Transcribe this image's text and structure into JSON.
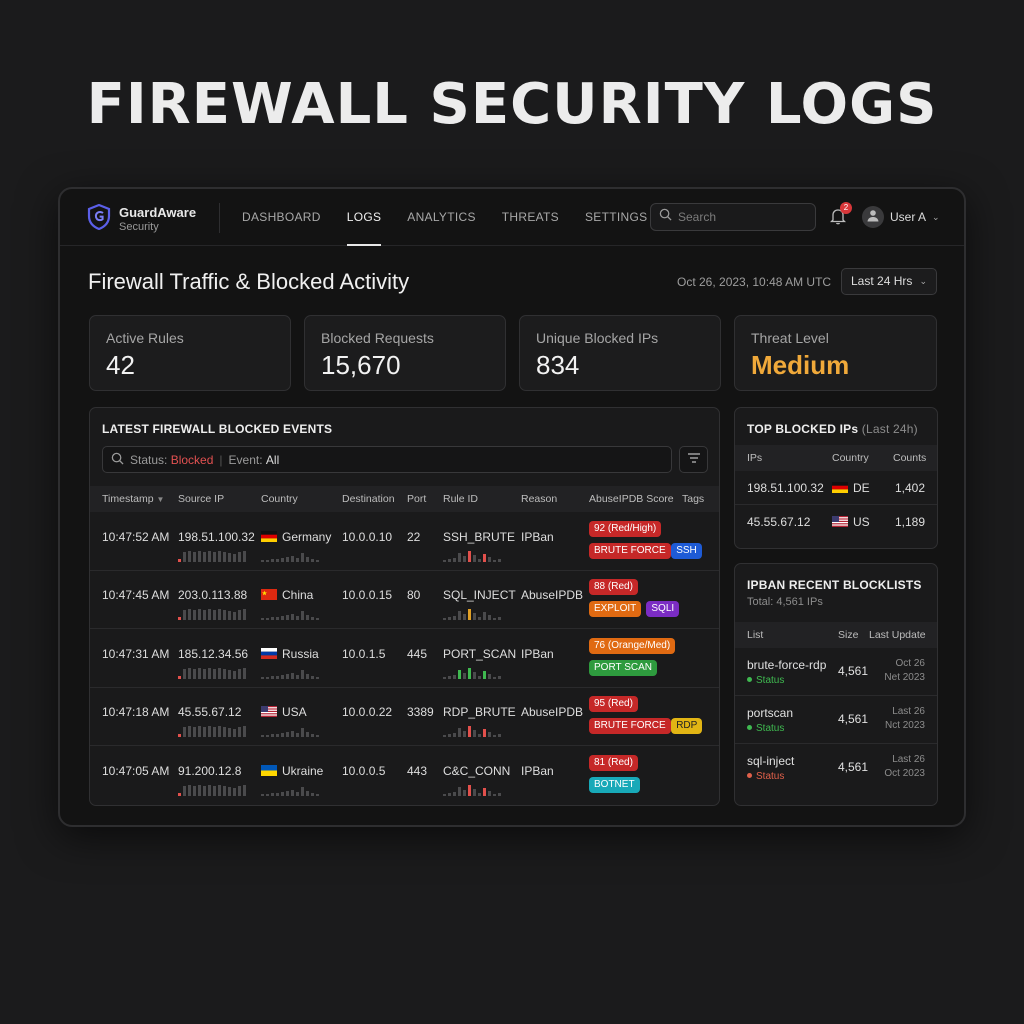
{
  "hero_title": "FIREWALL SECURITY LOGS",
  "app": {
    "name": "GuardAware",
    "subtitle": "Security"
  },
  "nav": [
    {
      "label": "DASHBOARD",
      "active": false
    },
    {
      "label": "LOGS",
      "active": true
    },
    {
      "label": "ANALYTICS",
      "active": false
    },
    {
      "label": "THREATS",
      "active": false
    },
    {
      "label": "SETTINGS",
      "active": false
    }
  ],
  "search": {
    "placeholder": "Search"
  },
  "notifications": {
    "count": "2"
  },
  "user": {
    "name": "User A"
  },
  "page": {
    "title": "Firewall Traffic & Blocked Activity",
    "timestamp": "Oct 26, 2023, 10:48 AM UTC",
    "range": "Last 24 Hrs"
  },
  "stats": [
    {
      "label": "Active Rules",
      "value": "42"
    },
    {
      "label": "Blocked Requests",
      "value": "15,670"
    },
    {
      "label": "Unique Blocked IPs",
      "value": "834"
    },
    {
      "label": "Threat Level",
      "value": "Medium"
    }
  ],
  "events": {
    "title": "LATEST FIREWALL BLOCKED EVENTS",
    "filter": {
      "status_label": "Status:",
      "status_value": "Blocked",
      "event_label": "Event:",
      "event_value": "All"
    },
    "columns": [
      "Timestamp",
      "Source IP",
      "Country",
      "Destination",
      "Port",
      "Rule ID",
      "Reason",
      "AbuseIPDB Score",
      "Tags"
    ],
    "rows": [
      {
        "time": "10:47:52 AM",
        "ip": "198.51.100.32",
        "country": "Germany",
        "flag": "de",
        "dest": "10.0.0.10",
        "port": "22",
        "rule": "SSH_BRUTE",
        "reason": "IPBan",
        "score": "92 (Red/High)",
        "score_color": "#c62828",
        "tags": [
          {
            "label": "BRUTE FORCE",
            "color": "#c62828"
          },
          {
            "label": "SSH",
            "color": "#1e5bd6"
          }
        ]
      },
      {
        "time": "10:47:45 AM",
        "ip": "203.0.113.88",
        "country": "China",
        "flag": "cn",
        "dest": "10.0.0.15",
        "port": "80",
        "rule": "SQL_INJECT",
        "reason": "AbuseIPDB",
        "score": "88 (Red)",
        "score_color": "#c62828",
        "tags": [
          {
            "label": "EXPLOIT",
            "color": "#e06a12"
          },
          {
            "label": "SQLI",
            "color": "#7b2cc4"
          }
        ]
      },
      {
        "time": "10:47:31 AM",
        "ip": "185.12.34.56",
        "country": "Russia",
        "flag": "ru",
        "dest": "10.0.1.5",
        "port": "445",
        "rule": "PORT_SCAN",
        "reason": "IPBan",
        "score": "76 (Orange/Med)",
        "score_color": "#e06a12",
        "tags": [
          {
            "label": "PORT SCAN",
            "color": "#2e9b3e"
          }
        ]
      },
      {
        "time": "10:47:18 AM",
        "ip": "45.55.67.12",
        "country": "USA",
        "flag": "us",
        "dest": "10.0.0.22",
        "port": "3389",
        "rule": "RDP_BRUTE",
        "reason": "AbuseIPDB",
        "score": "95 (Red)",
        "score_color": "#c62828",
        "tags": [
          {
            "label": "BRUTE FORCE",
            "color": "#c62828"
          },
          {
            "label": "RDP",
            "color": "#e2b514"
          }
        ]
      },
      {
        "time": "10:47:05 AM",
        "ip": "91.200.12.8",
        "country": "Ukraine",
        "flag": "ua",
        "dest": "10.0.0.5",
        "port": "443",
        "rule": "C&C_CONN",
        "reason": "IPBan",
        "score": "81 (Red)",
        "score_color": "#c62828",
        "tags": [
          {
            "label": "BOTNET",
            "color": "#18a9b8"
          }
        ]
      }
    ]
  },
  "top_ips": {
    "title": "TOP BLOCKED IPs",
    "title_suffix": "(Last 24h)",
    "columns": [
      "IPs",
      "Country",
      "Counts"
    ],
    "rows": [
      {
        "ip": "198.51.100.32",
        "country": "DE",
        "flag": "de",
        "count": "1,402"
      },
      {
        "ip": "45.55.67.12",
        "country": "US",
        "flag": "us",
        "count": "1,189"
      }
    ]
  },
  "blocklists": {
    "title": "IPBAN RECENT BLOCKLISTS",
    "total": "Total: 4,561 IPs",
    "columns": [
      "List",
      "Size",
      "Last Update"
    ],
    "rows": [
      {
        "name": "brute-force-rdp",
        "status": "Status",
        "status_color": "#3fb950",
        "size": "4,561",
        "update_1": "Oct 26",
        "update_2": "Net 2023"
      },
      {
        "name": "portscan",
        "status": "Status",
        "status_color": "#3fb950",
        "size": "4,561",
        "update_1": "Last 26",
        "update_2": "Nct 2023"
      },
      {
        "name": "sql-inject",
        "status": "Status",
        "status_color": "#e0604a",
        "size": "4,561",
        "update_1": "Last 26",
        "update_2": "Oct 2023"
      }
    ]
  },
  "colors": {
    "accent_warning": "#f0a93a",
    "danger": "#e25151",
    "background": "#131313"
  }
}
